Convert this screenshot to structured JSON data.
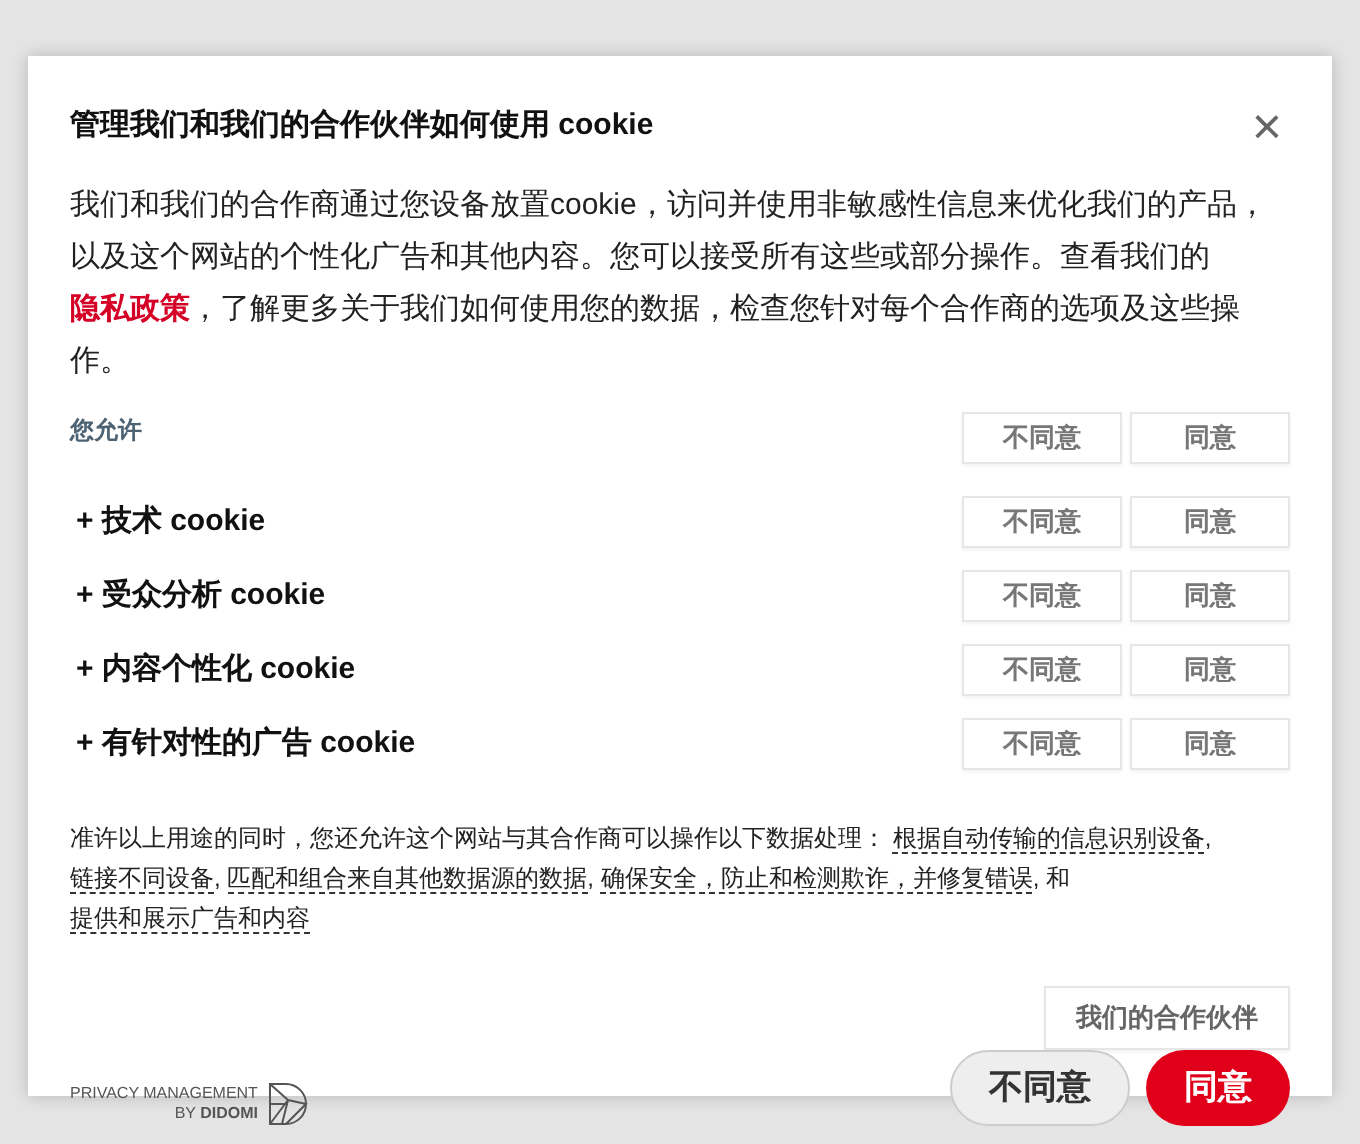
{
  "dialog": {
    "title": "管理我们和我们的合作伙伴如何使用 cookie",
    "close": "×",
    "description": {
      "before": "我们和我们的合作商通过您设备放置cookie，访问并使用非敏感性信息来优化我们的产品，以及这个网站的个性化广告和其他内容。您可以接受所有这些或部分操作。查看我们的",
      "link": "隐私政策",
      "after": "，了解更多关于我们如何使用您的数据，检查您针对每个合作商的选项及这些操作。"
    },
    "allow_header": {
      "label": "您允许",
      "disagree": "不同意",
      "agree": "同意"
    },
    "purposes": [
      {
        "label": "+ 技术 cookie",
        "disagree": "不同意",
        "agree": "同意"
      },
      {
        "label": "+ 受众分析 cookie",
        "disagree": "不同意",
        "agree": "同意"
      },
      {
        "label": "+ 内容个性化 cookie",
        "disagree": "不同意",
        "agree": "同意"
      },
      {
        "label": "+ 有针对性的广告 cookie",
        "disagree": "不同意",
        "agree": "同意"
      }
    ],
    "processing": {
      "intro": "准许以上用途的同时，您还允许这个网站与其合作商可以操作以下数据处理：",
      "items": [
        {
          "kind": "link",
          "text": "根据自动传输的信息识别设备"
        },
        {
          "kind": "sep",
          "text": ","
        },
        {
          "kind": "link",
          "text": "链接不同设备"
        },
        {
          "kind": "sep",
          "text": ","
        },
        {
          "kind": "link",
          "text": "匹配和组合来自其他数据源的数据"
        },
        {
          "kind": "sep",
          "text": ","
        },
        {
          "kind": "link",
          "text": "确保安全，防止和检测欺诈，并修复错误"
        },
        {
          "kind": "sep",
          "text": ", 和"
        },
        {
          "kind": "link",
          "text": "提供和展示广告和内容"
        }
      ]
    },
    "partners_button": "我们的合作伙伴",
    "branding": {
      "line1": "PRIVACY MANAGEMENT",
      "line2": "BY **DIDOMI**"
    },
    "buttons": {
      "disagree": "不同意",
      "agree": "同意"
    }
  }
}
